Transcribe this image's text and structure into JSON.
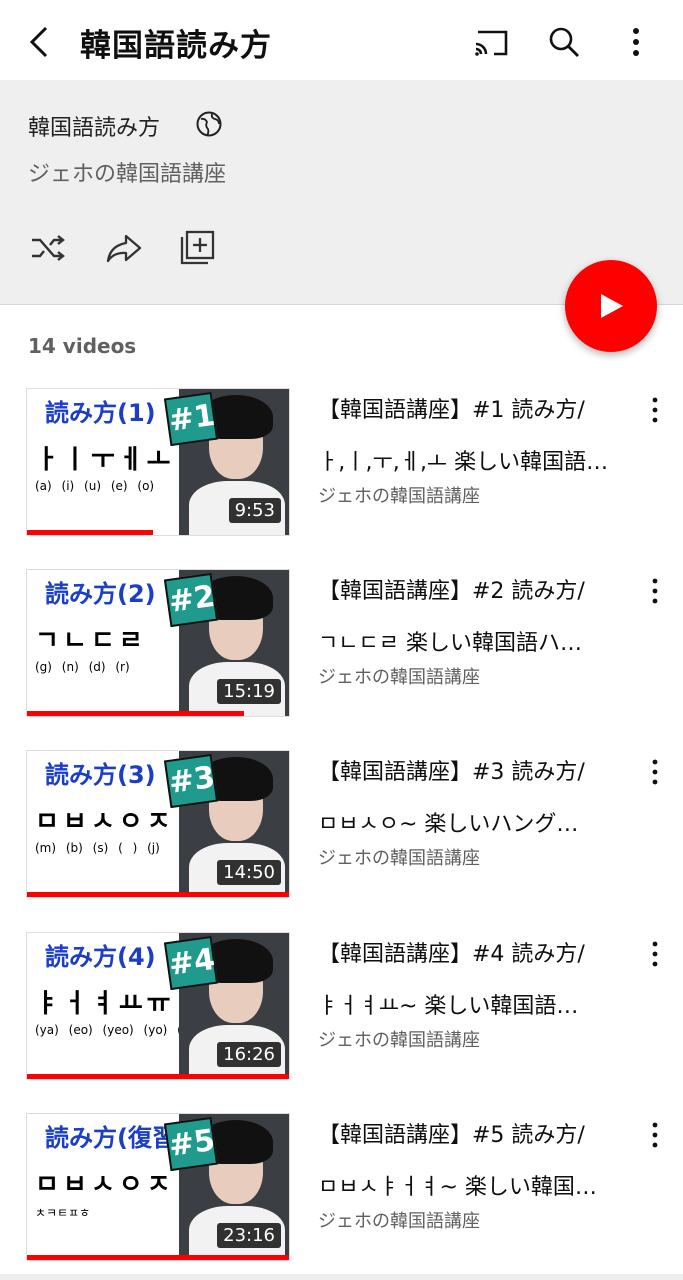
{
  "topbar": {
    "title": "韓国語読み方",
    "icons": [
      "back-arrow-icon",
      "cast-icon",
      "search-icon",
      "more-vert-icon"
    ]
  },
  "playlist": {
    "title": "韓国語読み方",
    "visibility_icon": "globe-icon",
    "channel": "ジェホの韓国語講座",
    "actions": [
      "shuffle-icon",
      "share-icon",
      "add-to-playlist-icon"
    ],
    "play_button_icon": "play-icon",
    "count": "14 videos"
  },
  "colors": {
    "accent": "#ff0000",
    "header_bg": "#efefef",
    "thumb_title": "#1b3ec9",
    "badge": "#1f9a8c"
  },
  "videos": [
    {
      "title_line1": "【韓国語講座】#1 読み方/",
      "title_line2": "ㅏ,ㅣ,ㅜ,ㅔ,ㅗ 楽しい韓国語…",
      "channel": "ジェホの韓国語講座",
      "duration": "9:53",
      "progress": 0.48,
      "thumb_heading": "読み方(1)",
      "thumb_badge": "#1",
      "thumb_hangul": "ㅏㅣㅜㅔㅗ",
      "thumb_roman": "(a) (i) (u) (e) (o)"
    },
    {
      "title_line1": "【韓国語講座】#2 読み方/",
      "title_line2": "ㄱㄴㄷㄹ 楽しい韓国語ハ…",
      "channel": "ジェホの韓国語講座",
      "duration": "15:19",
      "progress": 0.83,
      "thumb_heading": "読み方(2)",
      "thumb_badge": "#2",
      "thumb_hangul": "ㄱㄴㄷㄹ",
      "thumb_roman": "(g) (n) (d) (r)"
    },
    {
      "title_line1": "【韓国語講座】#3 読み方/",
      "title_line2": "ㅁㅂㅅㅇ~ 楽しいハング…",
      "channel": "ジェホの韓国語講座",
      "duration": "14:50",
      "progress": 1.0,
      "thumb_heading": "読み方(3)",
      "thumb_badge": "#3",
      "thumb_hangul": "ㅁㅂㅅㅇㅈ",
      "thumb_roman": "(m) (b) (s) ( ) (j)"
    },
    {
      "title_line1": "【韓国語講座】#4 読み方/",
      "title_line2": "ㅑㅓㅕㅛ~ 楽しい韓国語…",
      "channel": "ジェホの韓国語講座",
      "duration": "16:26",
      "progress": 1.0,
      "thumb_heading": "読み方(4)",
      "thumb_badge": "#4",
      "thumb_hangul": "ㅑㅓㅕㅛㅠ",
      "thumb_roman": "(ya) (eo) (yeo) (yo) (yu)"
    },
    {
      "title_line1": "【韓国語講座】#5 読み方/",
      "title_line2": "ㅁㅂㅅㅑㅓㅕ~ 楽しい韓国…",
      "channel": "ジェホの韓国語講座",
      "duration": "23:16",
      "progress": 1.0,
      "thumb_heading": "読み方(復習)",
      "thumb_badge": "#5",
      "thumb_hangul": "ㅁㅂㅅㅇㅈ",
      "thumb_roman": "ㅊㅋㅌㅍㅎ"
    }
  ]
}
